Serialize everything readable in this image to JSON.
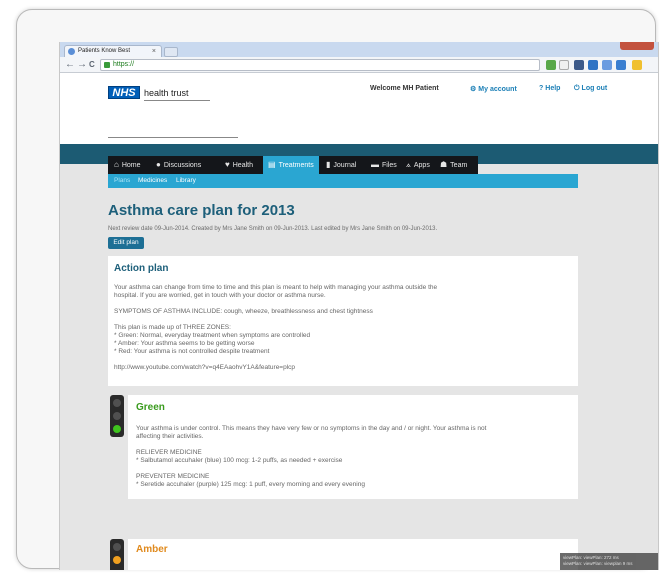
{
  "browser": {
    "tab_title": "Patients Know Best",
    "tab_close": "×",
    "url": "https://",
    "nav": {
      "back": "←",
      "forward": "→",
      "reload": "C"
    }
  },
  "header": {
    "logo": "NHS",
    "trust": "health trust",
    "welcome": "Welcome MH Patient",
    "links": [
      {
        "icon": "⚙",
        "label": "My account"
      },
      {
        "icon": "?",
        "label": "Help"
      },
      {
        "icon": "⏻",
        "label": "Log out"
      }
    ]
  },
  "main_nav": [
    {
      "icon": "⌂",
      "label": "Home"
    },
    {
      "icon": "●",
      "label": "Discussions"
    },
    {
      "icon": "♥",
      "label": "Health"
    },
    {
      "icon": "▤",
      "label": "Treatments",
      "active": true
    },
    {
      "icon": "▮",
      "label": "Journal"
    },
    {
      "icon": "▬",
      "label": "Files"
    },
    {
      "icon": "⟑",
      "label": "Apps"
    },
    {
      "icon": "☗",
      "label": "Team"
    }
  ],
  "sub_nav": [
    {
      "label": "Plans",
      "active": true
    },
    {
      "label": "Medicines"
    },
    {
      "label": "Library"
    }
  ],
  "plan": {
    "title": "Asthma care plan for 2013",
    "review": "Next review date 09-Jun-2014. Created by Mrs Jane Smith on 09-Jun-2013. Last edited by Mrs Jane Smith on 09-Jun-2013.",
    "edit_label": "Edit plan"
  },
  "action_plan": {
    "title": "Action plan",
    "lines": [
      "Your asthma can change from time to time and this plan is meant to help with managing your asthma outside the",
      "hospital. If you are worried, get in touch with your doctor or asthma nurse.",
      "SYMPTOMS OF ASTHMA INCLUDE: cough, wheeze, breathlessness and chest tightness",
      "This plan is made up of THREE ZONES:",
      "* Green: Normal, everyday treatment when symptoms are controlled",
      "* Amber: Your asthma seems to be getting worse",
      "* Red: Your asthma is not controlled despite treatment",
      "http://www.youtube.com/watch?v=q4EAaohvY1A&feature=plcp"
    ]
  },
  "zones": {
    "green": {
      "title": "Green",
      "color": "#3a9b1e",
      "lines": [
        "Your asthma is under control. This means they have very few or no symptoms in the day and / or night. Your asthma is not",
        "affecting their activities.",
        "RELIEVER MEDICINE",
        "* Salbutamol accuhaler (blue) 100 mcg: 1-2 puffs, as needed + exercise",
        "PREVENTER MEDICINE",
        "* Seretide accuhaler (purple) 125 mcg: 1 puff, every morning and every evening"
      ]
    },
    "amber": {
      "title": "Amber",
      "color": "#e08a1e"
    }
  },
  "devbar": {
    "line1": "viewPlan: viewPlan: 272 ms",
    "line2": "viewPlan: viewPlan: viewplan 9 ms"
  },
  "colors": {
    "accent": "#2aa6d2",
    "title": "#1d5f7a",
    "header_bar": "#1c5b73",
    "nav_bg": "#14161a"
  }
}
